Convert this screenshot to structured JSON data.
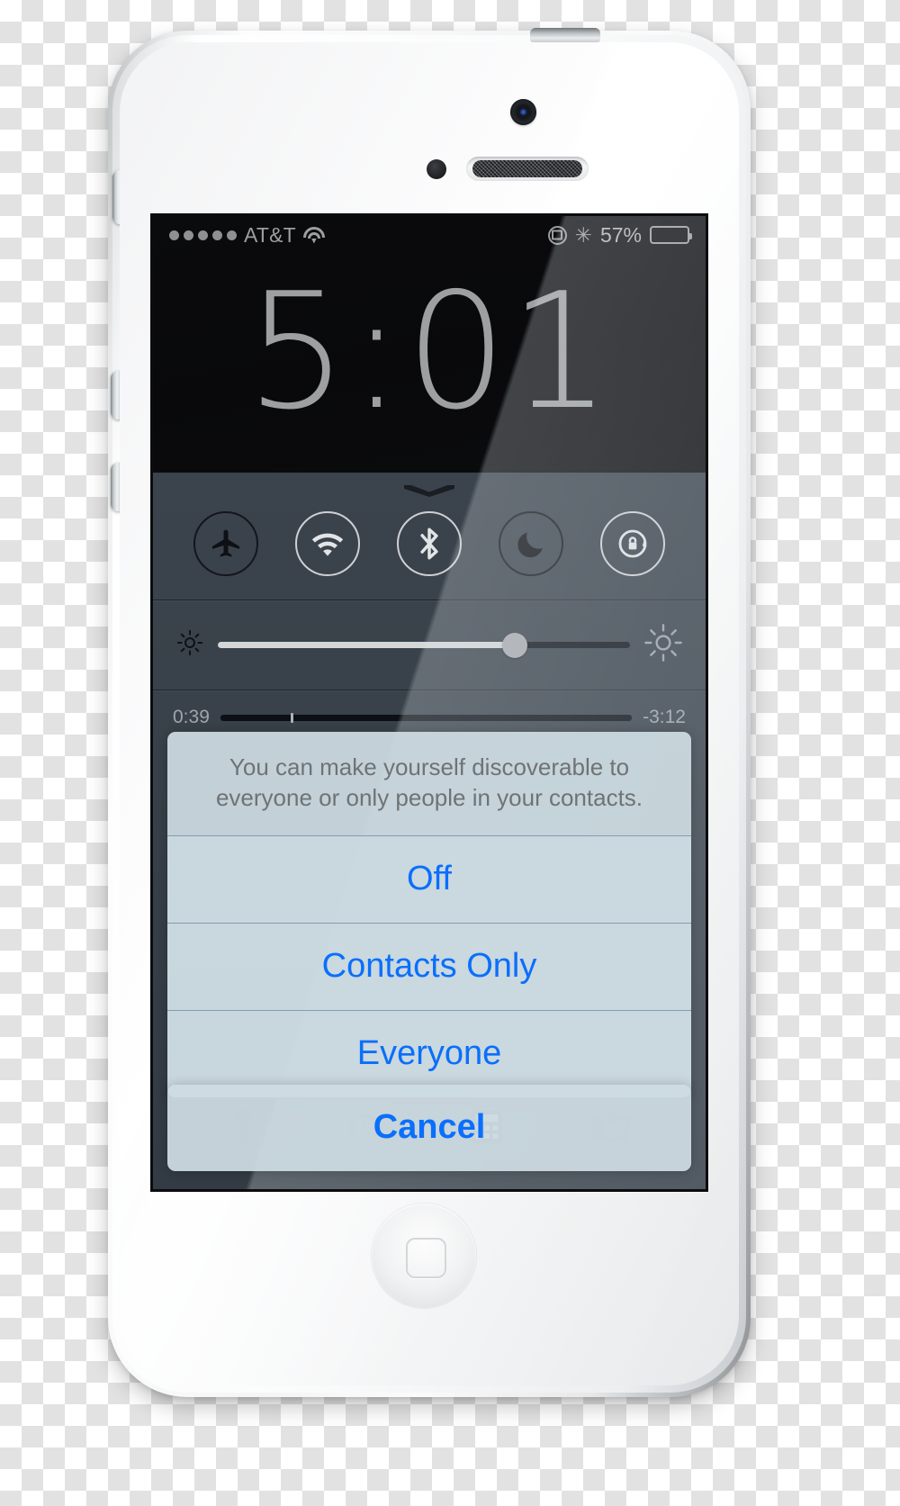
{
  "device": {
    "name": "iPhone 5 (white)"
  },
  "status_bar": {
    "signal_dots": 5,
    "carrier": "AT&T",
    "wifi_icon": "wifi-icon",
    "rotation_lock_icon": "rotation-lock-icon",
    "bluetooth_icon": "bluetooth-icon",
    "bluetooth_glyph": "✳",
    "battery_percent": "57%",
    "battery_fill_pct": 57
  },
  "lockscreen": {
    "time": "5:01"
  },
  "control_center": {
    "toggles": [
      {
        "name": "airplane-mode-toggle",
        "icon": "airplane-icon",
        "active": false
      },
      {
        "name": "wifi-toggle",
        "icon": "wifi-icon",
        "active": true
      },
      {
        "name": "bluetooth-toggle",
        "icon": "bluetooth-icon",
        "active": true
      },
      {
        "name": "do-not-disturb-toggle",
        "icon": "moon-icon",
        "active": false
      },
      {
        "name": "rotation-lock-toggle",
        "icon": "rotation-lock-icon",
        "active": true
      }
    ],
    "brightness": {
      "label_low": "brightness-low-icon",
      "label_high": "brightness-high-icon",
      "value_pct": 72
    },
    "media": {
      "elapsed": "0:39",
      "remaining": "-3:12",
      "progress_pct": 17
    },
    "shortcuts": [
      {
        "name": "flashlight-shortcut",
        "icon": "flashlight-icon"
      },
      {
        "name": "timer-shortcut",
        "icon": "timer-icon"
      },
      {
        "name": "calculator-shortcut",
        "icon": "calculator-icon"
      },
      {
        "name": "camera-shortcut",
        "icon": "camera-icon"
      }
    ]
  },
  "action_sheet": {
    "message": "You can make yourself discoverable to everyone or only people in your contacts.",
    "options": [
      {
        "label": "Off"
      },
      {
        "label": "Contacts Only"
      },
      {
        "label": "Everyone"
      }
    ],
    "cancel_label": "Cancel"
  },
  "colors": {
    "tint_blue": "#0a6ffb",
    "sheet_background": "#cddbe2",
    "control_center_bg": "#39414a",
    "status_text": "#9c9ea0"
  }
}
